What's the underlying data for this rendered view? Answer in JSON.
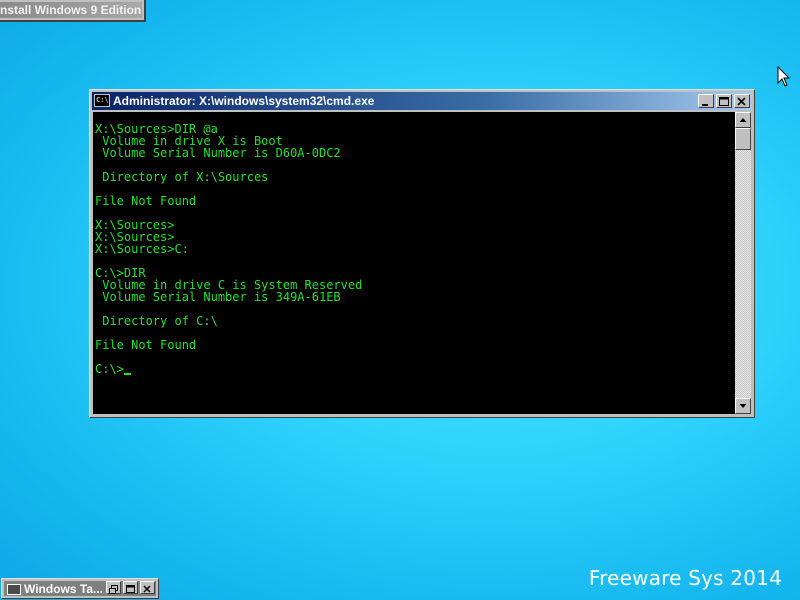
{
  "top_window": {
    "title": "nstall Windows 9 Edition"
  },
  "cmd": {
    "title": "Administrator: X:\\windows\\system32\\cmd.exe",
    "icon": "cmd-icon",
    "icon_label": "C:\\",
    "lines": [
      "X:\\Sources>DIR @a",
      " Volume in drive X is Boot",
      " Volume Serial Number is D60A-0DC2",
      "",
      " Directory of X:\\Sources",
      "",
      "File Not Found",
      "",
      "X:\\Sources>",
      "X:\\Sources>",
      "X:\\Sources>C:",
      "",
      "C:\\>DIR",
      " Volume in drive C is System Reserved",
      " Volume Serial Number is 349A-61EB",
      "",
      " Directory of C:\\",
      "",
      "File Not Found",
      "",
      "C:\\>"
    ],
    "text_color": "#22e02e",
    "background_color": "#000000"
  },
  "taskbar_window": {
    "title": "Windows Ta..."
  },
  "watermark": {
    "text": "Freeware Sys 2014"
  }
}
